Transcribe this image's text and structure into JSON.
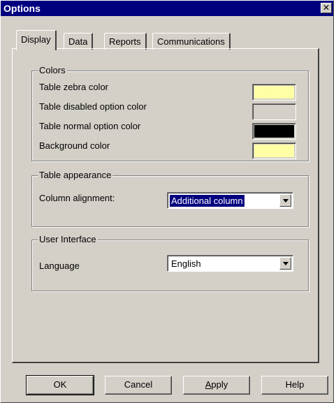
{
  "window": {
    "title": "Options",
    "close_glyph": "✕"
  },
  "tabs": [
    {
      "label": "Display",
      "active": true
    },
    {
      "label": "Data",
      "active": false
    },
    {
      "label": "Reports",
      "active": false
    },
    {
      "label": "Communications",
      "active": false
    }
  ],
  "colors_group": {
    "title": "Colors",
    "items": [
      {
        "label": "Table zebra color",
        "color": "#ffff99"
      },
      {
        "label": "Table disabled option color",
        "color": "#d4d0c8"
      },
      {
        "label": "Table normal option color",
        "color": "#000000"
      },
      {
        "label": "Background color",
        "color": "#ffff99"
      }
    ]
  },
  "table_appearance": {
    "title": "Table appearance",
    "column_alignment_label": "Column alignment:",
    "column_alignment_value": "Additional column"
  },
  "user_interface": {
    "title": "User Interface",
    "language_label": "Language",
    "language_value": "English"
  },
  "buttons": {
    "ok": "OK",
    "cancel": "Cancel",
    "apply_mnemonic": "A",
    "apply_rest": "pply",
    "help": "Help"
  }
}
